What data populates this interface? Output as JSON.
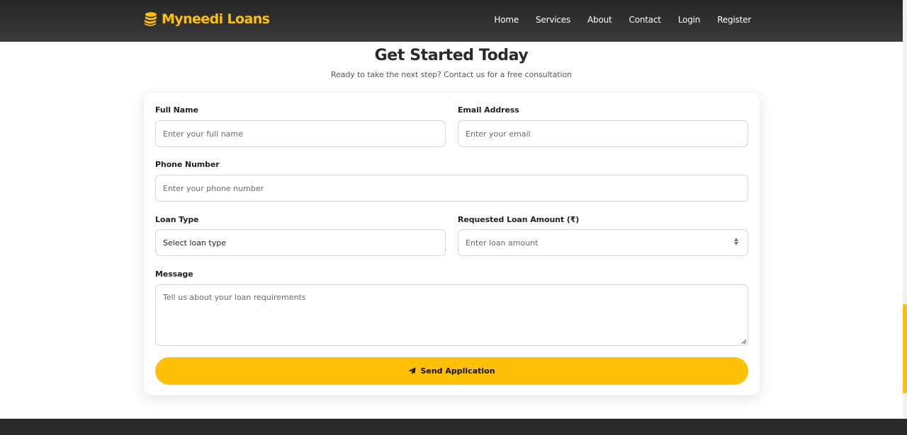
{
  "brand": {
    "name": "Myneedi Loans",
    "icon": "coins-icon",
    "accent": "#ffc107"
  },
  "nav": {
    "items": [
      {
        "label": "Home"
      },
      {
        "label": "Services"
      },
      {
        "label": "About"
      },
      {
        "label": "Contact"
      },
      {
        "label": "Login"
      },
      {
        "label": "Register"
      }
    ]
  },
  "section": {
    "title": "Get Started Today",
    "subtitle": "Ready to take the next step? Contact us for a free consultation"
  },
  "form": {
    "full_name": {
      "label": "Full Name",
      "placeholder": "Enter your full name",
      "value": ""
    },
    "email": {
      "label": "Email Address",
      "placeholder": "Enter your email",
      "value": ""
    },
    "phone": {
      "label": "Phone Number",
      "placeholder": "Enter your phone number",
      "value": ""
    },
    "loan_type": {
      "label": "Loan Type",
      "selected": "Select loan type"
    },
    "loan_amount": {
      "label": "Requested Loan Amount (₹)",
      "placeholder": "Enter loan amount",
      "value": ""
    },
    "message": {
      "label": "Message",
      "placeholder": "Tell us about your loan requirements",
      "value": ""
    },
    "submit": {
      "label": "Send Application",
      "icon": "paper-plane-icon"
    }
  },
  "colors": {
    "navbar": "#2e2e2e",
    "accent": "#ffc107",
    "footer": "#2a2a2a"
  }
}
